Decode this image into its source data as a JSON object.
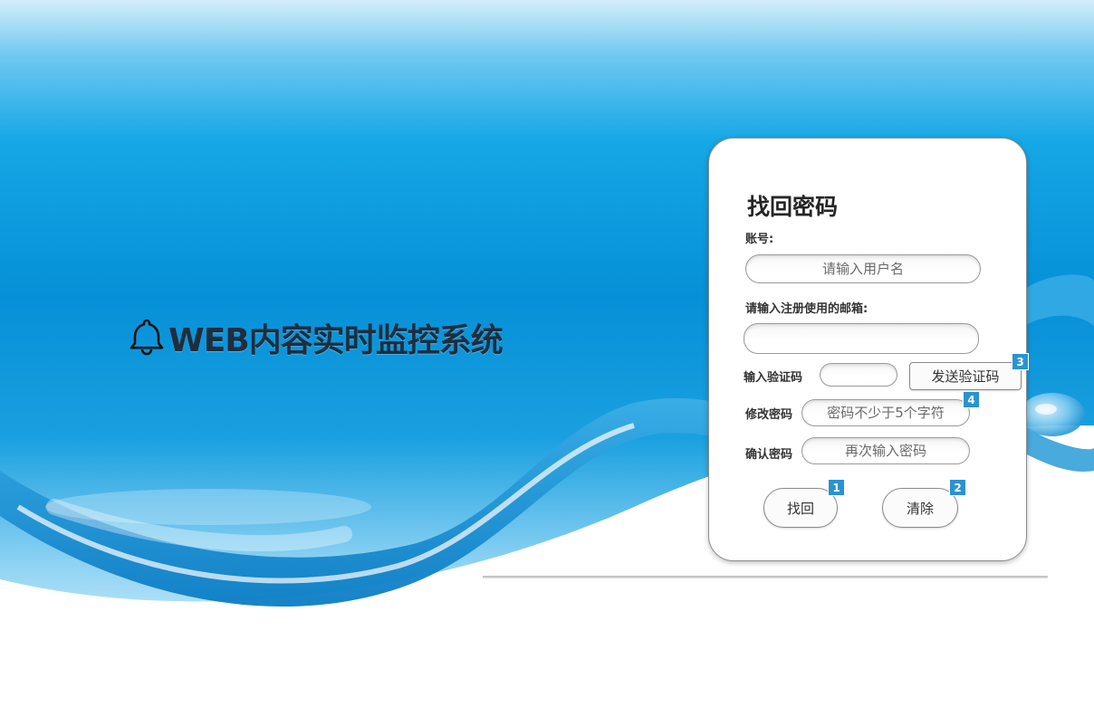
{
  "brand": {
    "icon": "bell-icon",
    "title": "WEB内容实时监控系统"
  },
  "form": {
    "title": "找回密码",
    "account_label": "账号:",
    "account_placeholder": "请输入用户名",
    "email_label": "请输入注册使用的邮箱:",
    "email_value": "",
    "code_label": "输入验证码",
    "code_value": "",
    "send_code_label": "发送验证码",
    "new_password_label": "修改密码",
    "new_password_placeholder": "密码不少于5个字符",
    "confirm_password_label": "确认密码",
    "confirm_password_placeholder": "再次输入密码",
    "submit_label": "找回",
    "clear_label": "清除"
  },
  "badges": {
    "submit": "1",
    "clear": "2",
    "send_code": "3",
    "new_password": "4"
  },
  "colors": {
    "sky": "#0a9be0",
    "badge": "#2a93d1",
    "card_border": "#8c8c8c"
  }
}
